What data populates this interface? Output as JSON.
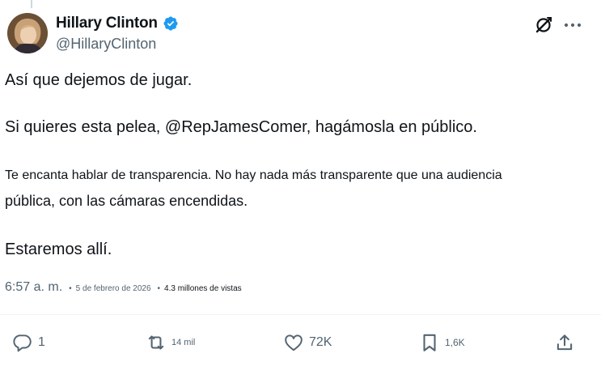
{
  "author": {
    "display_name": "Hillary Clinton",
    "handle": "@HillaryClinton",
    "verified_badge_icon": "verified-badge-icon",
    "badge_color": "#1d9bf0"
  },
  "post": {
    "paragraphs": [
      "Así que dejemos de jugar.",
      "Si quieres esta pelea, @RepJamesComer, hagámosla en público.",
      "Te encanta hablar de transparencia. No hay nada más transparente que una audiencia",
      "pública, con las cámaras encendidas.",
      "Estaremos allí."
    ]
  },
  "meta": {
    "time": "6:57 a. m.",
    "separator": "•",
    "date": "5 de febrero de 2026",
    "views": "4.3 millones de vistas"
  },
  "actions": {
    "reply": {
      "icon": "reply-icon",
      "count": "1"
    },
    "repost": {
      "icon": "repost-icon",
      "count": "14 mil"
    },
    "like": {
      "icon": "heart-icon",
      "count": "72K"
    },
    "bookmark": {
      "icon": "bookmark-icon",
      "count": "1,6K"
    },
    "share": {
      "icon": "share-icon"
    }
  },
  "header_icons": {
    "grok": "grok-icon",
    "more": "more-options-icon"
  },
  "colors": {
    "text_primary": "#0f1419",
    "text_secondary": "#536471",
    "accent": "#1d9bf0"
  }
}
